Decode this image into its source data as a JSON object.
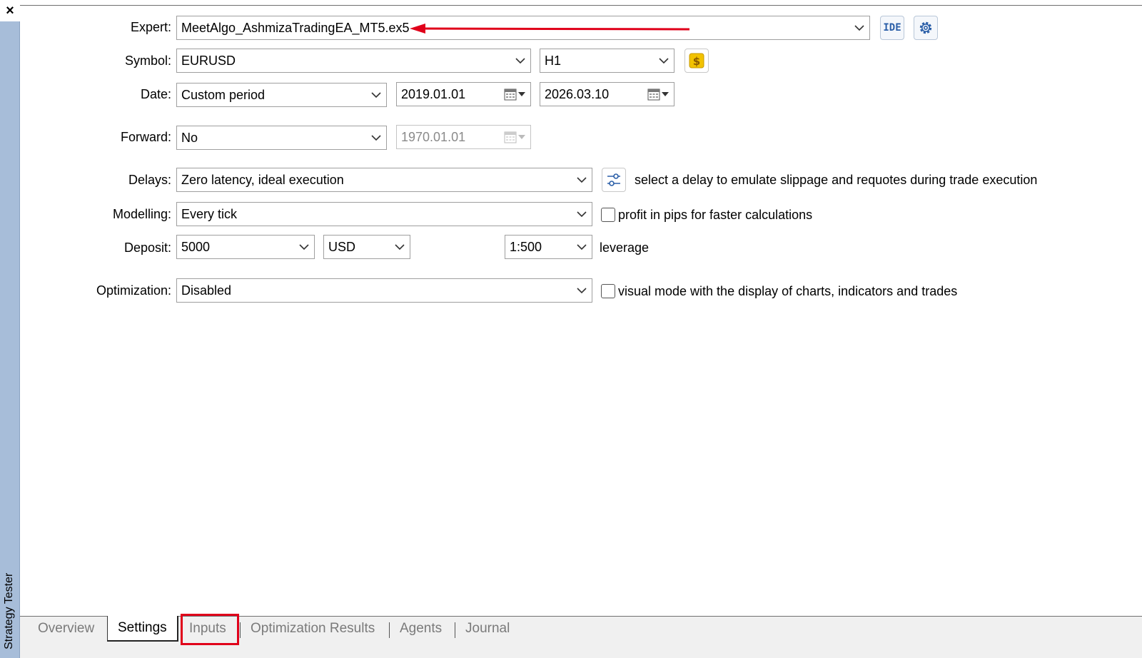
{
  "side_panel": {
    "close_glyph": "×",
    "title": "Strategy Tester"
  },
  "form": {
    "expert": {
      "label": "Expert:",
      "value": "MeetAlgo_AshmizaTradingEA_MT5.ex5",
      "ide_label": "IDE"
    },
    "symbol": {
      "label": "Symbol:",
      "value": "EURUSD",
      "timeframe": "H1"
    },
    "date": {
      "label": "Date:",
      "mode": "Custom period",
      "from": "2019.01.01",
      "to": "2026.03.10"
    },
    "forward": {
      "label": "Forward:",
      "value": "No",
      "date": "1970.01.01"
    },
    "delays": {
      "label": "Delays:",
      "value": "Zero latency, ideal execution",
      "hint": "select a delay to emulate slippage and requotes during trade execution"
    },
    "modelling": {
      "label": "Modelling:",
      "value": "Every tick",
      "checkbox_label": "profit in pips for faster calculations",
      "checked": false
    },
    "deposit": {
      "label": "Deposit:",
      "value": "5000",
      "currency": "USD",
      "leverage": "1:500",
      "leverage_label": "leverage"
    },
    "optimization": {
      "label": "Optimization:",
      "value": "Disabled",
      "checkbox_label": "visual mode with the display of charts, indicators and trades",
      "checked": false
    }
  },
  "tabs": [
    {
      "label": "Overview",
      "active": false
    },
    {
      "label": "Settings",
      "active": true
    },
    {
      "label": "Inputs",
      "active": false,
      "highlighted": true
    },
    {
      "label": "Optimization Results",
      "active": false
    },
    {
      "label": "Agents",
      "active": false
    },
    {
      "label": "Journal",
      "active": false
    }
  ],
  "colors": {
    "annotation_red": "#e0001a",
    "side_strip": "#a7bdd9",
    "icon_blue": "#2b5fa8",
    "coin_yellow": "#f2c200"
  },
  "icons": [
    "close-icon",
    "gear-icon",
    "dollar-coin-icon",
    "calendar-icon",
    "delay-settings-icon",
    "chevron-down-icon",
    "arrow-annotation-icon"
  ]
}
